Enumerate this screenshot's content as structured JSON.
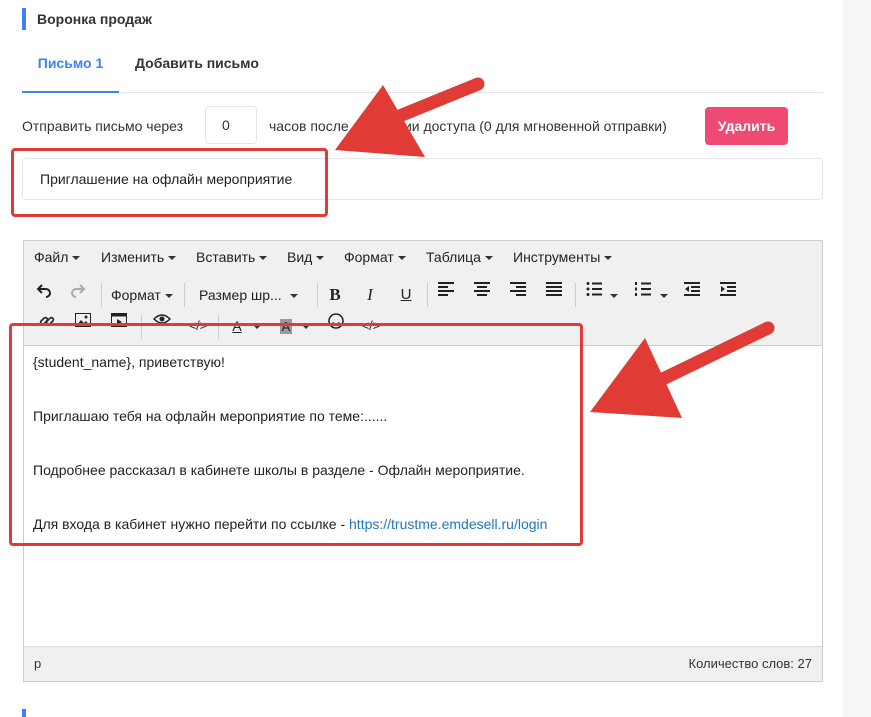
{
  "section": {
    "title": "Воронка продаж"
  },
  "tabs": [
    {
      "label": "Письмо 1",
      "active": true
    },
    {
      "label": "Добавить письмо",
      "active": false
    }
  ],
  "send_row": {
    "prefix": "Отправить письмо через",
    "hours_value": "0",
    "suffix": "часов после активации доступа (0 для мгновенной отправки)",
    "delete_label": "Удалить"
  },
  "subject": {
    "value": "Приглашение на офлайн мероприятие"
  },
  "editor": {
    "menu": [
      {
        "label": "Файл"
      },
      {
        "label": "Изменить"
      },
      {
        "label": "Вставить"
      },
      {
        "label": "Вид"
      },
      {
        "label": "Формат"
      },
      {
        "label": "Таблица"
      },
      {
        "label": "Инструменты"
      }
    ],
    "toolbar": {
      "format_label": "Формат",
      "font_size_label": "Размер шр..."
    },
    "body": {
      "greeting": "{student_name}, приветствую!",
      "line1": "Приглашаю тебя на офлайн мероприятие по теме:......",
      "line2": "Подробнее рассказал в кабинете школы в разделе - Офлайн мероприятие.",
      "line3_text": "Для входа в кабинет нужно перейти по ссылке - ",
      "line3_link": "https://trustme.emdesell.ru/login"
    },
    "status": {
      "path": "p",
      "word_count": "Количество слов: 27"
    }
  },
  "colors": {
    "accent": "#3b82f6",
    "delete": "#ef4a74",
    "annotation": "#e03b34",
    "link": "#2276c0"
  }
}
